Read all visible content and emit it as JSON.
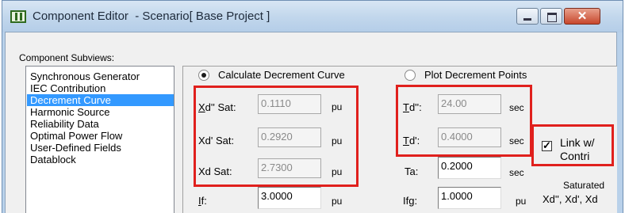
{
  "window": {
    "title": "Component Editor  - Scenario[ Base Project ]",
    "close_glyph": "✕"
  },
  "subviews": {
    "label": "Component Subviews:",
    "items": [
      "Synchronous Generator",
      "IEC Contribution",
      "Decrement Curve",
      "Harmonic Source",
      "Reliability Data",
      "Optimal Power Flow",
      "User-Defined Fields",
      "Datablock"
    ],
    "selected": "Decrement Curve"
  },
  "mode": {
    "calculate_label": "Calculate Decrement Curve",
    "plot_label": "Plot Decrement Points",
    "selected": "Calculate Decrement Curve"
  },
  "fields": {
    "xd2_sat": {
      "label_u": "X",
      "label_rest": "d'' Sat:",
      "value": "0.1110",
      "unit": "pu"
    },
    "xd1_sat": {
      "label": "Xd' Sat:",
      "value": "0.2920",
      "unit": "pu"
    },
    "xd_sat": {
      "label": "Xd Sat:",
      "value": "2.7300",
      "unit": "pu"
    },
    "if": {
      "label_u": "I",
      "label_rest": "f:",
      "value": "3.0000",
      "unit": "pu"
    },
    "td2": {
      "label_u": "T",
      "label_rest": "d'':",
      "value": "24.00",
      "unit": "sec"
    },
    "td1": {
      "label_u": "T",
      "label_rest": "d':",
      "value": "0.4000",
      "unit": "sec"
    },
    "ta": {
      "label": "Ta:",
      "value": "0.2000",
      "unit": "sec"
    },
    "ifg": {
      "label": "Ifg:",
      "value": "1.0000",
      "unit": "pu"
    }
  },
  "link_contri": {
    "line1": "Link w/",
    "line2": "Contri",
    "checked": true
  },
  "saturated_note": {
    "line1": "Saturated",
    "line2": "Xd'', Xd', Xd"
  },
  "colors": {
    "highlight": "#e0201d",
    "selection": "#3399ff",
    "title_bar": "#c2d7ec"
  }
}
